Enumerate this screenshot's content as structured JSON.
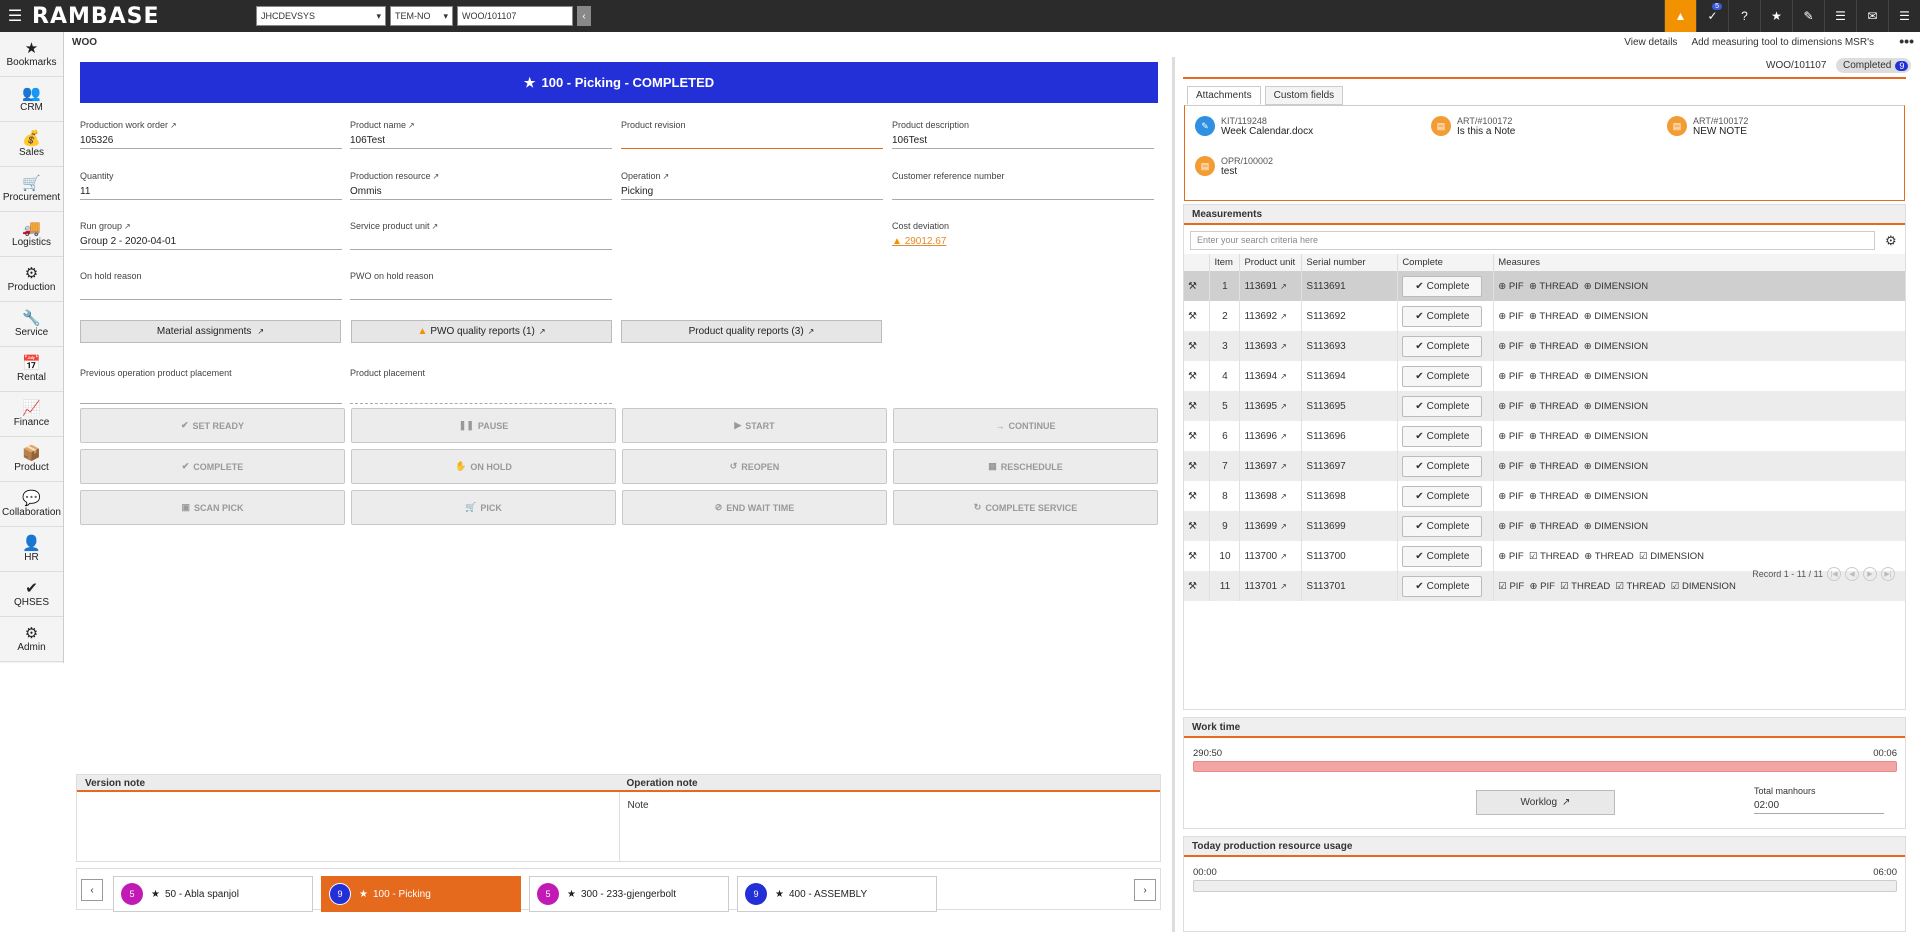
{
  "topbar": {
    "logo": "RAMBASE",
    "company": "JHCDEVSYS",
    "role": "TEM-NO",
    "location": "WOO/101107",
    "notif_count": "5"
  },
  "sidebar": [
    {
      "icon": "★",
      "label": "Bookmarks",
      "name": "bookmarks"
    },
    {
      "icon": "👥",
      "label": "CRM",
      "name": "crm"
    },
    {
      "icon": "💰",
      "label": "Sales",
      "name": "sales"
    },
    {
      "icon": "🛒",
      "label": "Procurement",
      "name": "procurement"
    },
    {
      "icon": "🚚",
      "label": "Logistics",
      "name": "logistics"
    },
    {
      "icon": "⚙",
      "label": "Production",
      "name": "production"
    },
    {
      "icon": "🔧",
      "label": "Service",
      "name": "service"
    },
    {
      "icon": "📅",
      "label": "Rental",
      "name": "rental"
    },
    {
      "icon": "📈",
      "label": "Finance",
      "name": "finance"
    },
    {
      "icon": "📦",
      "label": "Product",
      "name": "product"
    },
    {
      "icon": "💬",
      "label": "Collaboration",
      "name": "collaboration"
    },
    {
      "icon": "👤",
      "label": "HR",
      "name": "hr"
    },
    {
      "icon": "✔",
      "label": "QHSES",
      "name": "qhses"
    },
    {
      "icon": "⚙",
      "label": "Admin",
      "name": "admin"
    }
  ],
  "header": {
    "title": "WOO",
    "link1": "View details",
    "link2": "Add measuring tool to dimensions MSR's"
  },
  "banner": {
    "title": "100 - Picking - COMPLETED"
  },
  "fields": {
    "pwo_label": "Production work order",
    "pwo": "105326",
    "pname_label": "Product name",
    "pname": "106Test",
    "prev_label": "Product revision",
    "prev": "",
    "pdesc_label": "Product description",
    "pdesc": "106Test",
    "qty_label": "Quantity",
    "qty": "11",
    "pres_label": "Production resource",
    "pres": "Ommis",
    "op_label": "Operation",
    "op": "Picking",
    "custref_label": "Customer reference number",
    "custref": "",
    "rg_label": "Run group",
    "rg": "Group 2 - 2020-04-01",
    "spu_label": "Service product unit",
    "spu": "",
    "cd_label": "Cost deviation",
    "cd": "29012.67",
    "ohr_label": "On hold reason",
    "ohr": "",
    "pwohr_label": "PWO on hold reason",
    "pwohr": "",
    "popp_label": "Previous operation product placement",
    "popp": "",
    "pp_label": "Product placement",
    "pp": ""
  },
  "gbuttons": {
    "mat": "Material assignments",
    "pwoq": "PWO quality reports (1)",
    "pq": "Product quality reports (3)"
  },
  "actions": [
    "SET READY",
    "PAUSE",
    "START",
    "CONTINUE",
    "COMPLETE",
    "ON HOLD",
    "REOPEN",
    "RESCHEDULE",
    "SCAN PICK",
    "PICK",
    "END WAIT TIME",
    "COMPLETE SERVICE"
  ],
  "notes": {
    "version": "Version note",
    "operation": "Operation note",
    "op_body": "Note"
  },
  "ops": [
    {
      "count": "5",
      "label": "50 - Abla spanjol",
      "color": "#c21bb5"
    },
    {
      "count": "9",
      "label": "100 - Picking",
      "color": "#2330d8"
    },
    {
      "count": "5",
      "label": "300 - 233-gjengerbolt",
      "color": "#c21bb5"
    },
    {
      "count": "9",
      "label": "400 - ASSEMBLY",
      "color": "#2330d8"
    }
  ],
  "right": {
    "id": "WOO/101107",
    "status": "Completed",
    "status_count": "9",
    "tabs": [
      "Attachments",
      "Custom fields"
    ],
    "attachments": [
      {
        "id": "KIT/119248",
        "name": "Week Calendar.docx",
        "color": "#2f8fe0"
      },
      {
        "id": "ART/#100172",
        "name": "Is this a Note",
        "color": "#f39c33"
      },
      {
        "id": "ART/#100172",
        "name": "NEW NOTE",
        "color": "#f39c33"
      },
      {
        "id": "OPR/100002",
        "name": "test",
        "color": "#f39c33"
      }
    ],
    "meas_title": "Measurements",
    "search_placeholder": "Enter your search criteria here",
    "cols": [
      "",
      "Item",
      "Product unit",
      "Serial number",
      "Complete",
      "Measures"
    ],
    "complete_label": "Complete",
    "rows": [
      {
        "item": "1",
        "pu": "113691",
        "sn": "S113691",
        "m": "⊕ PIF  ⊕ THREAD  ⊕ DIMENSION"
      },
      {
        "item": "2",
        "pu": "113692",
        "sn": "S113692",
        "m": "⊕ PIF  ⊕ THREAD  ⊕ DIMENSION"
      },
      {
        "item": "3",
        "pu": "113693",
        "sn": "S113693",
        "m": "⊕ PIF  ⊕ THREAD  ⊕ DIMENSION"
      },
      {
        "item": "4",
        "pu": "113694",
        "sn": "S113694",
        "m": "⊕ PIF  ⊕ THREAD  ⊕ DIMENSION"
      },
      {
        "item": "5",
        "pu": "113695",
        "sn": "S113695",
        "m": "⊕ PIF  ⊕ THREAD  ⊕ DIMENSION"
      },
      {
        "item": "6",
        "pu": "113696",
        "sn": "S113696",
        "m": "⊕ PIF  ⊕ THREAD  ⊕ DIMENSION"
      },
      {
        "item": "7",
        "pu": "113697",
        "sn": "S113697",
        "m": "⊕ PIF  ⊕ THREAD  ⊕ DIMENSION"
      },
      {
        "item": "8",
        "pu": "113698",
        "sn": "S113698",
        "m": "⊕ PIF  ⊕ THREAD  ⊕ DIMENSION"
      },
      {
        "item": "9",
        "pu": "113699",
        "sn": "S113699",
        "m": "⊕ PIF  ⊕ THREAD  ⊕ DIMENSION"
      },
      {
        "item": "10",
        "pu": "113700",
        "sn": "S113700",
        "m": "⊕ PIF  ☑ THREAD  ⊕ THREAD  ☑ DIMENSION"
      },
      {
        "item": "11",
        "pu": "113701",
        "sn": "S113701",
        "m": "☑ PIF  ⊕ PIF  ☑ THREAD  ☑ THREAD  ☑ DIMENSION"
      }
    ],
    "record": "Record 1 - 11 / 11",
    "worktime_title": "Work time",
    "wt_start": "290:50",
    "wt_end": "00:06",
    "worklog": "Worklog",
    "manhours_label": "Total manhours",
    "manhours": "02:00",
    "usage_title": "Today production resource usage",
    "u_start": "00:00",
    "u_end": "06:00"
  }
}
